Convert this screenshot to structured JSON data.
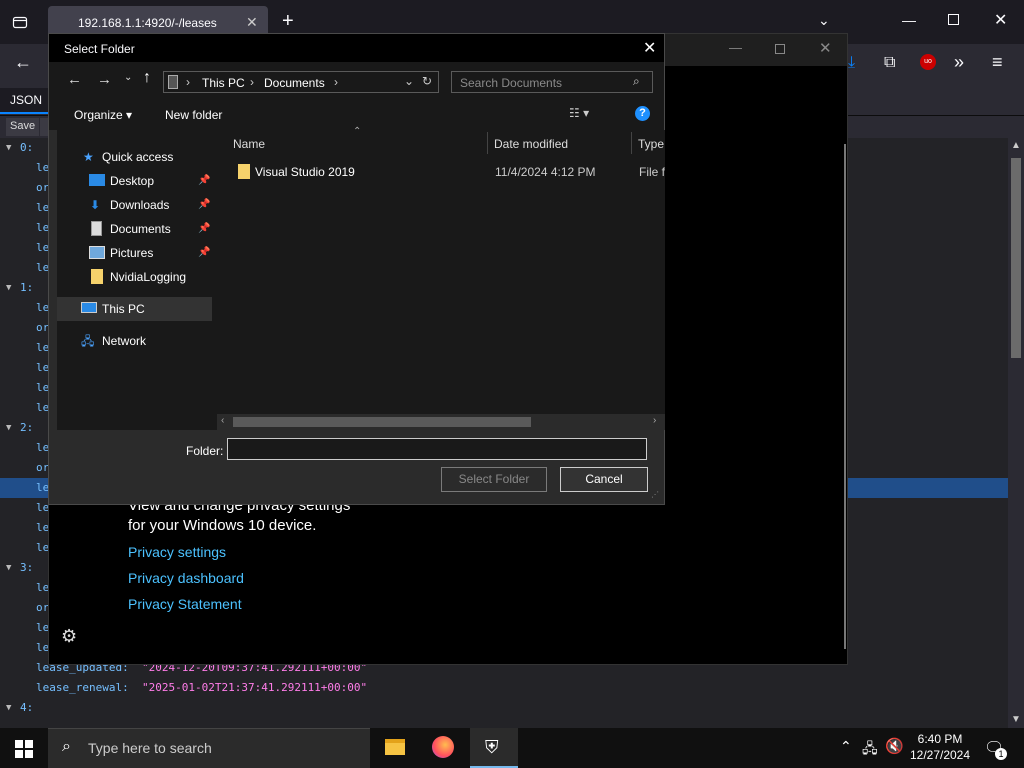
{
  "browser": {
    "tab_title": "192.168.1.1:4920/-/leases",
    "new_tab": "+"
  },
  "json_viewer": {
    "tab_label": "JSON",
    "save_label": "Save",
    "rows": [
      {
        "indent": 0,
        "text": "0:",
        "kind": "idx"
      },
      {
        "indent": 1,
        "text": "le",
        "kind": "key"
      },
      {
        "indent": 1,
        "text": "or",
        "kind": "key"
      },
      {
        "indent": 1,
        "text": "le",
        "kind": "key"
      },
      {
        "indent": 1,
        "text": "le",
        "kind": "key"
      },
      {
        "indent": 1,
        "text": "le",
        "kind": "key"
      },
      {
        "indent": 1,
        "text": "le",
        "kind": "key"
      },
      {
        "indent": 0,
        "text": "1:",
        "kind": "idx"
      },
      {
        "indent": 1,
        "text": "le",
        "kind": "key"
      },
      {
        "indent": 1,
        "text": "or",
        "kind": "key"
      },
      {
        "indent": 1,
        "text": "le",
        "kind": "key"
      },
      {
        "indent": 1,
        "text": "le",
        "kind": "key"
      },
      {
        "indent": 1,
        "text": "le",
        "kind": "key"
      },
      {
        "indent": 1,
        "text": "le",
        "kind": "key"
      },
      {
        "indent": 0,
        "text": "2:",
        "kind": "idx"
      },
      {
        "indent": 1,
        "text": "le",
        "kind": "key"
      },
      {
        "indent": 1,
        "text": "or",
        "kind": "key"
      },
      {
        "indent": 1,
        "text": "le",
        "kind": "key",
        "selected": true
      },
      {
        "indent": 1,
        "text": "le",
        "kind": "key"
      },
      {
        "indent": 1,
        "text": "le",
        "kind": "key"
      },
      {
        "indent": 1,
        "text": "le",
        "kind": "key"
      },
      {
        "indent": 0,
        "text": "3:",
        "kind": "idx"
      },
      {
        "indent": 1,
        "text": "le",
        "kind": "key"
      },
      {
        "indent": 1,
        "text": "or",
        "kind": "key"
      },
      {
        "indent": 1,
        "text": "le",
        "kind": "key"
      },
      {
        "indent": 1,
        "text": "le",
        "kind": "key"
      },
      {
        "indent": 1,
        "text": "lease_updated:",
        "value": "\"2024-12-20T09:37:41.292111+00:00\"",
        "kind": "key"
      },
      {
        "indent": 1,
        "text": "lease_renewal:",
        "value": "\"2025-01-02T21:37:41.292111+00:00\"",
        "kind": "key"
      },
      {
        "indent": 0,
        "text": "4:",
        "kind": "idx"
      }
    ]
  },
  "settings": {
    "line1": "View and change privacy settings",
    "line2": "for your Windows 10 device.",
    "links": [
      "Privacy settings",
      "Privacy dashboard",
      "Privacy Statement"
    ]
  },
  "dialog": {
    "title": "Select Folder",
    "breadcrumb": [
      "This PC",
      "Documents"
    ],
    "search_placeholder": "Search Documents",
    "organize_label": "Organize",
    "new_folder_label": "New folder",
    "nav": {
      "quick_access": "Quick access",
      "items": [
        "Desktop",
        "Downloads",
        "Documents",
        "Pictures",
        "NvidiaLogging"
      ],
      "this_pc": "This PC",
      "network": "Network"
    },
    "columns": [
      "Name",
      "Date modified",
      "Type"
    ],
    "files": [
      {
        "name": "Visual Studio 2019",
        "date": "11/4/2024 4:12 PM",
        "type": "File fo"
      }
    ],
    "folder_label": "Folder:",
    "folder_value": "",
    "select_button": "Select Folder",
    "cancel_button": "Cancel"
  },
  "taskbar": {
    "search_placeholder": "Type here to search",
    "time": "6:40 PM",
    "date": "12/27/2024",
    "notification_count": "1"
  }
}
